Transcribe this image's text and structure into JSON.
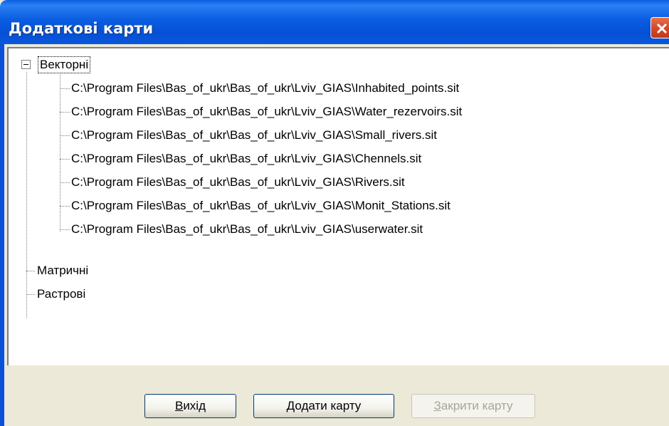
{
  "window": {
    "title": "Додаткові карти"
  },
  "tree": {
    "root_vector": "Векторні",
    "vector_items": [
      "C:\\Program Files\\Bas_of_ukr\\Bas_of_ukr\\Lviv_GIAS\\Inhabited_points.sit",
      "C:\\Program Files\\Bas_of_ukr\\Bas_of_ukr\\Lviv_GIAS\\Water_rezervoirs.sit",
      "C:\\Program Files\\Bas_of_ukr\\Bas_of_ukr\\Lviv_GIAS\\Small_rivers.sit",
      "C:\\Program Files\\Bas_of_ukr\\Bas_of_ukr\\Lviv_GIAS\\Chennels.sit",
      "C:\\Program Files\\Bas_of_ukr\\Bas_of_ukr\\Lviv_GIAS\\Rivers.sit",
      "C:\\Program Files\\Bas_of_ukr\\Bas_of_ukr\\Lviv_GIAS\\Monit_Stations.sit",
      "C:\\Program Files\\Bas_of_ukr\\Bas_of_ukr\\Lviv_GIAS\\userwater.sit"
    ],
    "root_matrix": "Матричні",
    "root_raster": "Растрові"
  },
  "buttons": {
    "exit": {
      "hotkey": "В",
      "rest": "ихід"
    },
    "add_map": {
      "hotkey": "Д",
      "rest": "одати карту"
    },
    "close_map": {
      "hotkey": "З",
      "rest": "акрити карту"
    }
  },
  "colors": {
    "title_bar": "#0a5ce0",
    "close_button": "#d8482a",
    "dialog_bg": "#ece9d8"
  }
}
